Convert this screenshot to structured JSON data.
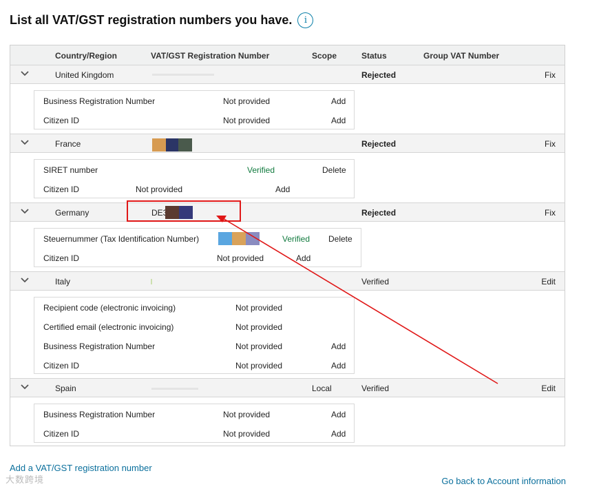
{
  "page_title": "List all VAT/GST registration numbers you have.",
  "info_icon": "i",
  "columns": {
    "country": "Country/Region",
    "vat": "VAT/GST Registration Number",
    "scope": "Scope",
    "status": "Status",
    "group": "Group VAT Number"
  },
  "rows": [
    {
      "country": "United Kingdom",
      "status": "Rejected",
      "action": "Fix",
      "details": [
        {
          "label": "Business Registration Number",
          "value": "Not provided",
          "action": "Add"
        },
        {
          "label": "Citizen ID",
          "value": "Not provided",
          "action": "Add"
        }
      ]
    },
    {
      "country": "France",
      "status": "Rejected",
      "action": "Fix",
      "details": [
        {
          "label": "SIRET number",
          "value": "Verified",
          "action": "Delete"
        },
        {
          "label": "Citizen ID",
          "value": "Not provided",
          "action": "Add"
        }
      ]
    },
    {
      "country": "Germany",
      "vat_prefix": "DE3",
      "status": "Rejected",
      "action": "Fix",
      "details": [
        {
          "label": "Steuernummer (Tax Identification Number)",
          "value": "Verified",
          "action": "Delete"
        },
        {
          "label": "Citizen ID",
          "value": "Not provided",
          "action": "Add"
        }
      ]
    },
    {
      "country": "Italy",
      "status": "Verified",
      "action": "Edit",
      "details": [
        {
          "label": "Recipient code (electronic invoicing)",
          "value": "Not provided"
        },
        {
          "label": "Certified email (electronic invoicing)",
          "value": "Not provided"
        },
        {
          "label": "Business Registration Number",
          "value": "Not provided",
          "action": "Add"
        },
        {
          "label": "Citizen ID",
          "value": "Not provided",
          "action": "Add"
        }
      ]
    },
    {
      "country": "Spain",
      "scope": "Local",
      "status": "Verified",
      "action": "Edit",
      "details": [
        {
          "label": "Business Registration Number",
          "value": "Not provided",
          "action": "Add"
        },
        {
          "label": "Citizen ID",
          "value": "Not provided",
          "action": "Add"
        }
      ]
    }
  ],
  "footer": {
    "add_link": "Add a VAT/GST registration number",
    "back_link": "Go back to Account information"
  },
  "watermark": "大数跨境",
  "colors": {
    "rejected": "#c40000",
    "verified": "#117a3e",
    "link": "#0a6f9c",
    "annotation": "#e01717"
  }
}
